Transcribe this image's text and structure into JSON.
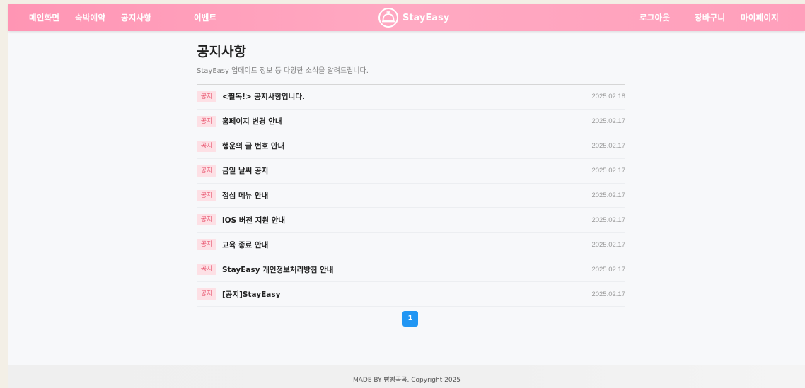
{
  "nav": {
    "left": [
      "메인화면",
      "숙박예약",
      "공지사항",
      "이벤트"
    ],
    "right": [
      "로그아웃",
      "장바구니",
      "마이페이지"
    ],
    "logo_text": "StayEasy"
  },
  "page": {
    "title": "공지사항",
    "description": "StayEasy 업데이트 정보 등 다양한 소식을 알려드립니다."
  },
  "notices": [
    {
      "badge": "공지",
      "title": "<필독!> 공지사항입니다.",
      "date": "2025.02.18"
    },
    {
      "badge": "공지",
      "title": "홈페이지 변경 안내",
      "date": "2025.02.17"
    },
    {
      "badge": "공지",
      "title": "행운의 글 번호 안내",
      "date": "2025.02.17"
    },
    {
      "badge": "공지",
      "title": "금일 날씨 공지",
      "date": "2025.02.17"
    },
    {
      "badge": "공지",
      "title": "점심 메뉴 안내",
      "date": "2025.02.17"
    },
    {
      "badge": "공지",
      "title": "iOS 버전 지원 안내",
      "date": "2025.02.17"
    },
    {
      "badge": "공지",
      "title": "교육 종료 안내",
      "date": "2025.02.17"
    },
    {
      "badge": "공지",
      "title": "StayEasy 개인정보처리방침 안내",
      "date": "2025.02.17"
    },
    {
      "badge": "공지",
      "title": "[공지]StayEasy",
      "date": "2025.02.17"
    }
  ],
  "pagination": {
    "current": "1"
  },
  "footer": {
    "text": "MADE BY 빵빵곡곡. Copyright 2025"
  },
  "colors": {
    "navbar": "#ff9fbb",
    "badge_text": "#e8556f",
    "badge_bg": "#fde0e5",
    "pagination_active": "#2196f3"
  }
}
